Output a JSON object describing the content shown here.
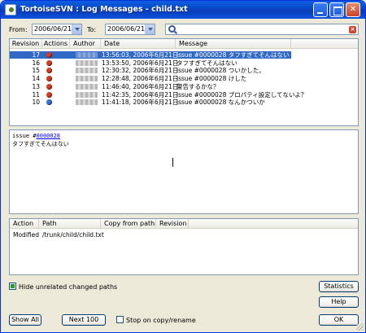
{
  "window": {
    "title": "TortoiseSVN : Log Messages - child.txt"
  },
  "filters": {
    "from_label": "From:",
    "from_value": "2006/06/21",
    "to_label": "To:",
    "to_value": "2006/06/21",
    "search_value": ""
  },
  "log_table": {
    "columns": [
      "Revision",
      "Actions",
      "Author",
      "Date",
      "Message"
    ],
    "rows": [
      {
        "revision": "17",
        "action": "modified",
        "date": "13:56:03, 2006年6月21日",
        "message": "issue #0000028 タフすぎてそんはない",
        "selected": true
      },
      {
        "revision": "16",
        "action": "modified",
        "date": "13:53:50, 2006年6月21日",
        "message": "タフすぎてそんはない"
      },
      {
        "revision": "15",
        "action": "modified",
        "date": "12:30:32, 2006年6月21日",
        "message": "issue #0000028 ついかした。"
      },
      {
        "revision": "14",
        "action": "modified",
        "date": "12:28:48, 2006年6月21日",
        "message": "issue #0000028 けした"
      },
      {
        "revision": "13",
        "action": "modified",
        "date": "11:46:40, 2006年6月21日",
        "message": "警告するかな？"
      },
      {
        "revision": "11",
        "action": "modified",
        "date": "11:42:35, 2006年6月21日",
        "message": "issue #0000028 プロパティ設定してないよ？"
      },
      {
        "revision": "10",
        "action": "added",
        "date": "11:41:18, 2006年6月21日",
        "message": "issue #0000028 なんかついか"
      }
    ]
  },
  "message_box": {
    "prefix": "issue #",
    "issue_link": "0000028",
    "body": "タフすぎてそんはない"
  },
  "paths_table": {
    "columns": [
      "Action",
      "Path",
      "Copy from path",
      "Revision"
    ],
    "rows": [
      {
        "action": "Modified",
        "path": "/trunk/child/child.txt",
        "copy_from": "",
        "revision": ""
      }
    ]
  },
  "options": {
    "hide_unrelated_label": "Hide unrelated changed paths",
    "hide_unrelated_checked": true,
    "stop_on_copy_label": "Stop on copy/rename",
    "stop_on_copy_checked": false
  },
  "buttons": {
    "statistics": "Statistics",
    "help": "Help",
    "show_all": "Show All",
    "next_100": "Next 100",
    "ok": "OK"
  }
}
